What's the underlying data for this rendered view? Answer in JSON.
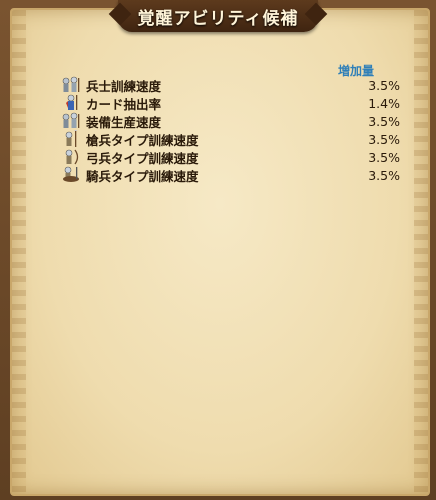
{
  "window": {
    "title": "覚醒アビリティ候補"
  },
  "table": {
    "value_header": "増加量",
    "rows": [
      {
        "label": "兵士訓練速度",
        "value": "3.5%",
        "icon": "soldiers-icon"
      },
      {
        "label": "カード抽出率",
        "value": "1.4%",
        "icon": "card-soldier-icon"
      },
      {
        "label": "装備生産速度",
        "value": "3.5%",
        "icon": "soldiers-icon"
      },
      {
        "label": "槍兵タイプ訓練速度",
        "value": "3.5%",
        "icon": "spearman-icon"
      },
      {
        "label": "弓兵タイプ訓練速度",
        "value": "3.5%",
        "icon": "archer-icon"
      },
      {
        "label": "騎兵タイプ訓練速度",
        "value": "3.5%",
        "icon": "cavalry-icon"
      }
    ]
  },
  "colors": {
    "accent": "#2f7fb8",
    "text": "#2a1a0a",
    "title_text": "#fff4d8",
    "title_bar": "#4b2d15"
  }
}
